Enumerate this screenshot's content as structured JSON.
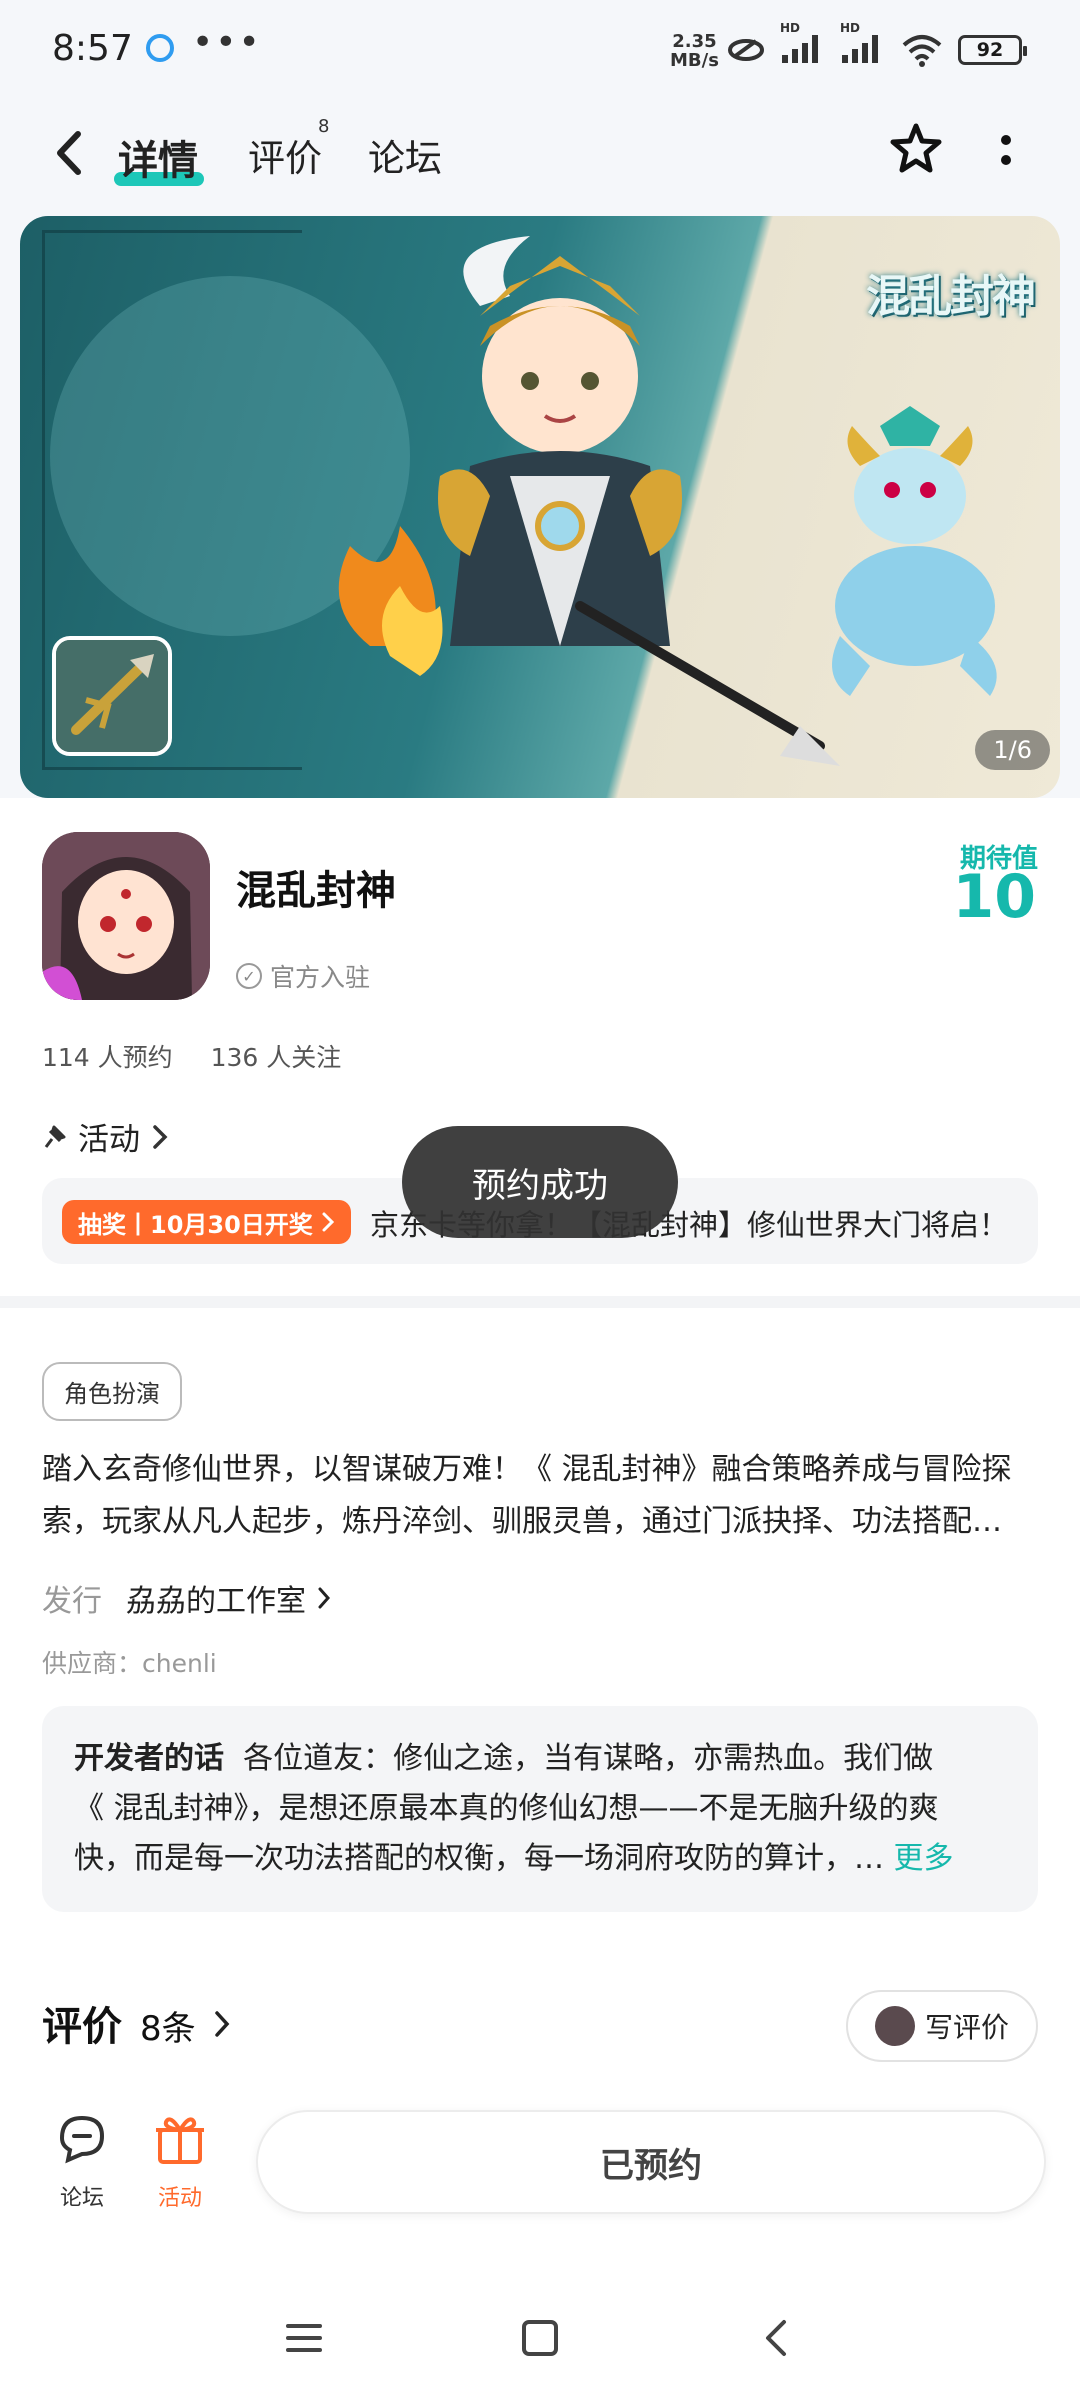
{
  "status_bar": {
    "time": "8:57",
    "network_speed_value": "2.35",
    "network_speed_unit": "MB/s",
    "signal_1_label": "HD",
    "signal_2_label": "HD",
    "battery": "92"
  },
  "nav": {
    "tabs": [
      {
        "label": "详情",
        "active": true
      },
      {
        "label": "评价",
        "badge": "8"
      },
      {
        "label": "论坛"
      }
    ]
  },
  "banner": {
    "logo_text": "混乱封神",
    "counter": "1/6"
  },
  "game": {
    "name": "混乱封神",
    "official_label": "官方入驻",
    "expect_label": "期待值",
    "expect_value": "10",
    "reservations": "114 人预约",
    "followers": "136 人关注"
  },
  "activity": {
    "title": "活动",
    "tag": "抽奖丨10月30日开奖",
    "text": "京东卡等你拿！【混乱封神】修仙世界大门将启！"
  },
  "details": {
    "genre": "角色扮演",
    "description": "踏入玄奇修仙世界，以智谋破万难！《 混乱封神》融合策略养成与冒险探索，玩家从凡人起步，炼丹淬剑、驯服灵兽，通过门派抉择、功法搭配…",
    "publisher_label": "发行",
    "publisher_name": "劦劦的工作室",
    "supplier": "供应商：chenli"
  },
  "developer": {
    "label": "开发者的话",
    "text_line1": "各位道友：修仙之途，当有谋略，亦需热血。我们做",
    "text_line2": "《 混乱封神》，是想还原最本真的修仙幻想——不是无脑升级的爽",
    "text_line3": "快，而是每一次功法搭配的权衡，每一场洞府攻防的算计，…",
    "more": "更多"
  },
  "reviews": {
    "title": "评价",
    "count": "8条",
    "write_button": "写评价"
  },
  "bottom_bar": {
    "forum_label": "论坛",
    "activity_label": "活动",
    "reserve_button": "已预约"
  },
  "toast": "预约成功",
  "colors": {
    "accent": "#16b8ac",
    "orange": "#ff6a2c"
  }
}
